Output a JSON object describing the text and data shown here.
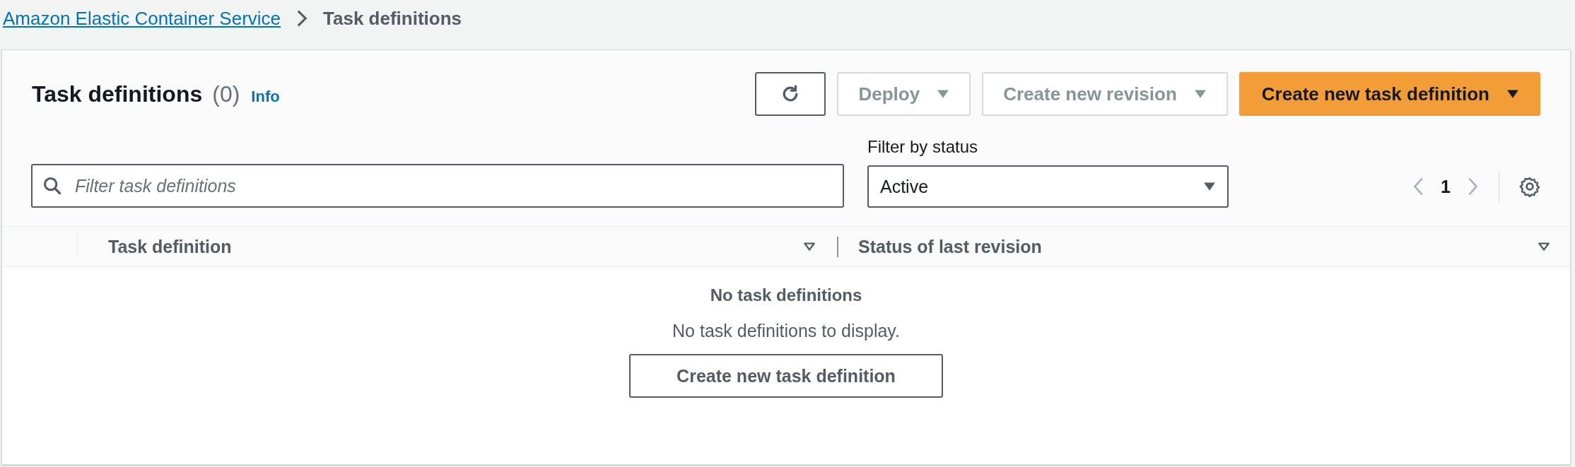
{
  "breadcrumb": [
    {
      "label": "Amazon Elastic Container Service",
      "link": true
    },
    {
      "label": "Task definitions",
      "link": false
    }
  ],
  "header": {
    "title": "Task definitions",
    "count": "(0)",
    "info": "Info"
  },
  "actions": [
    {
      "kind": "icon",
      "disabled": false
    },
    {
      "kind": "dropdown",
      "label": "Deploy",
      "disabled": true
    },
    {
      "kind": "dropdown",
      "label": "Create new revision",
      "disabled": true
    },
    {
      "kind": "primary",
      "label": "Create new task definition",
      "disabled": false
    }
  ],
  "search": {
    "placeholder": "Filter task definitions"
  },
  "status_filter": {
    "label": "Filter by status",
    "value": "Active"
  },
  "pagination": {
    "page": "1",
    "prev_disabled": true,
    "next_disabled": true
  },
  "table": {
    "columns": [
      "Task definition",
      "Status of last revision"
    ],
    "empty": {
      "title": "No task definitions",
      "message": "No task definitions to display.",
      "button": "Create new task definition"
    }
  }
}
